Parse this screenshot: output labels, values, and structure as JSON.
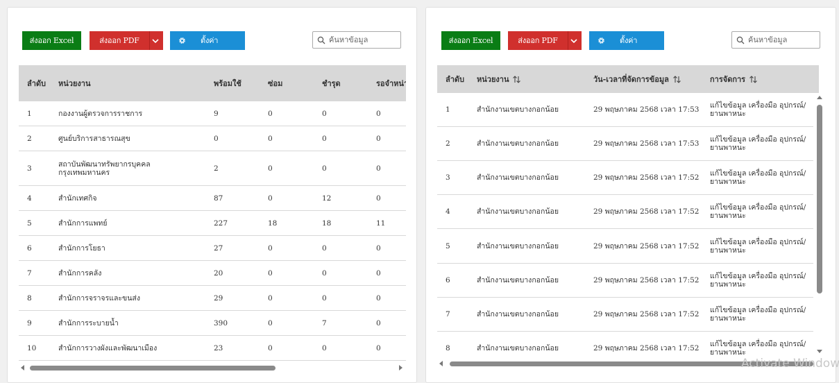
{
  "left_panel": {
    "toolbar": {
      "excel_label": "ส่งออก Excel",
      "pdf_label": "ส่งออก PDF",
      "settings_label": "ตั้งค่า"
    },
    "search": {
      "placeholder": "ค้นหาข้อมูล",
      "value": ""
    },
    "columns": [
      "ลำดับ",
      "หน่วยงาน",
      "พร้อมใช้",
      "ซ่อม",
      "ชำรุด",
      "รอจำหน่าย"
    ],
    "rows": [
      [
        "1",
        "กองงานผู้ตรวจการราชการ",
        "9",
        "0",
        "0",
        "0"
      ],
      [
        "2",
        "ศูนย์บริการสาธารณสุข",
        "0",
        "0",
        "0",
        "0"
      ],
      [
        "3",
        "สถาบันพัฒนาทรัพยากรบุคคล\nกรุงเทพมหานคร",
        "2",
        "0",
        "0",
        "0"
      ],
      [
        "4",
        "สำนักเทศกิจ",
        "87",
        "0",
        "12",
        "0"
      ],
      [
        "5",
        "สำนักการแพทย์",
        "227",
        "18",
        "18",
        "11"
      ],
      [
        "6",
        "สำนักการโยธา",
        "27",
        "0",
        "0",
        "0"
      ],
      [
        "7",
        "สำนักการคลัง",
        "20",
        "0",
        "0",
        "0"
      ],
      [
        "8",
        "สำนักการจราจรและขนส่ง",
        "29",
        "0",
        "0",
        "0"
      ],
      [
        "9",
        "สำนักการระบายน้ำ",
        "390",
        "0",
        "7",
        "0"
      ],
      [
        "10",
        "สำนักการวางผังและพัฒนาเมือง",
        "23",
        "0",
        "0",
        "0"
      ]
    ]
  },
  "right_panel": {
    "toolbar": {
      "excel_label": "ส่งออก Excel",
      "pdf_label": "ส่งออก PDF",
      "settings_label": "ตั้งค่า"
    },
    "search": {
      "placeholder": "ค้นหาข้อมูล",
      "value": ""
    },
    "columns": [
      "ลำดับ",
      "หน่วยงาน",
      "วัน-เวลาที่จัดการข้อมูล",
      "การจัดการ"
    ],
    "rows": [
      [
        "1",
        "สำนักงานเขตบางกอกน้อย",
        "29 พฤษภาคม 2568 เวลา 17:53",
        "แก้ไขข้อมูล เครื่องมือ อุปกรณ์/\nยานพาหนะ"
      ],
      [
        "2",
        "สำนักงานเขตบางกอกน้อย",
        "29 พฤษภาคม 2568 เวลา 17:53",
        "แก้ไขข้อมูล เครื่องมือ อุปกรณ์/\nยานพาหนะ"
      ],
      [
        "3",
        "สำนักงานเขตบางกอกน้อย",
        "29 พฤษภาคม 2568 เวลา 17:52",
        "แก้ไขข้อมูล เครื่องมือ อุปกรณ์/\nยานพาหนะ"
      ],
      [
        "4",
        "สำนักงานเขตบางกอกน้อย",
        "29 พฤษภาคม 2568 เวลา 17:52",
        "แก้ไขข้อมูล เครื่องมือ อุปกรณ์/\nยานพาหนะ"
      ],
      [
        "5",
        "สำนักงานเขตบางกอกน้อย",
        "29 พฤษภาคม 2568 เวลา 17:52",
        "แก้ไขข้อมูล เครื่องมือ อุปกรณ์/\nยานพาหนะ"
      ],
      [
        "6",
        "สำนักงานเขตบางกอกน้อย",
        "29 พฤษภาคม 2568 เวลา 17:52",
        "แก้ไขข้อมูล เครื่องมือ อุปกรณ์/\nยานพาหนะ"
      ],
      [
        "7",
        "สำนักงานเขตบางกอกน้อย",
        "29 พฤษภาคม 2568 เวลา 17:52",
        "แก้ไขข้อมูล เครื่องมือ อุปกรณ์/\nยานพาหนะ"
      ],
      [
        "8",
        "สำนักงานเขตบางกอกน้อย",
        "29 พฤษภาคม 2568 เวลา 17:52",
        "แก้ไขข้อมูล เครื่องมือ อุปกรณ์/\nยานพาหนะ"
      ]
    ]
  },
  "colors": {
    "excel": "#0a7d15",
    "pdf": "#d0302d",
    "settings": "#1b8fd6",
    "header_bg": "#d8d8d8"
  },
  "icons": {
    "settings": "gear-icon",
    "search": "search-icon",
    "pdf_menu": "chevron-down-icon",
    "sort": "sort-arrows-icon"
  },
  "watermark": "Activate Windows"
}
